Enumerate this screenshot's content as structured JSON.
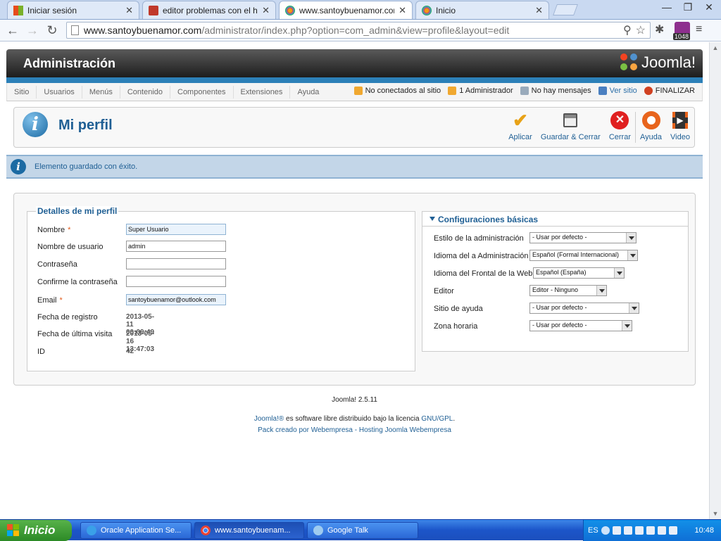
{
  "browser": {
    "tabs": [
      {
        "label": "Iniciar sesión",
        "active": false
      },
      {
        "label": "editor problemas con el html",
        "active": false
      },
      {
        "label": "www.santoybuenamor.com",
        "active": true
      },
      {
        "label": "Inicio",
        "active": false
      }
    ],
    "url_host": "www.santoybuenamor.com",
    "url_path": "/administrator/index.php?option=com_admin&view=profile&layout=edit",
    "badge_count": "1048"
  },
  "admin": {
    "header_title": "Administración",
    "logo_text": "Joomla!",
    "menu": [
      "Sitio",
      "Usuarios",
      "Menús",
      "Contenido",
      "Componentes",
      "Extensiones",
      "Ayuda"
    ],
    "status": {
      "not_connected": "No conectados al sitio",
      "admins": "1 Administrador",
      "messages": "No hay mensajes",
      "view_site": "Ver sitio",
      "logout": "FINALIZAR"
    }
  },
  "toolbar": {
    "page_title": "Mi perfil",
    "apply": "Aplicar",
    "save_close": "Guardar & Cerrar",
    "close": "Cerrar",
    "help": "Ayuda",
    "video": "Video"
  },
  "message": "Elemento guardado con éxito.",
  "profile": {
    "legend": "Detalles de mi perfil",
    "name_label": "Nombre",
    "name_value": "Super Usuario",
    "username_label": "Nombre de usuario",
    "username_value": "admin",
    "password_label": "Contraseña",
    "password_value": "",
    "confirm_label": "Confirme la contraseña",
    "confirm_value": "",
    "email_label": "Email",
    "email_value": "santoybuenamor@outlook.com",
    "register_label": "Fecha de registro",
    "register_value": "2013-05-11 00:09:49",
    "lastvisit_label": "Fecha de última visita",
    "lastvisit_value": "2013-05-16 13:47:03",
    "id_label": "ID",
    "id_value": "42",
    "required_mark": "*"
  },
  "settings": {
    "legend": "Configuraciones básicas",
    "admin_style_label": "Estilo de la administración",
    "admin_style_value": "- Usar por defecto -",
    "admin_lang_label": "Idioma del a Administración",
    "admin_lang_value": "Español (Formal Internacional)",
    "site_lang_label": "Idioma del Frontal de la Web",
    "site_lang_value": "Español (España)",
    "editor_label": "Editor",
    "editor_value": "Editor - Ninguno",
    "help_site_label": "Sitio de ayuda",
    "help_site_value": "- Usar por defecto -",
    "timezone_label": "Zona horaria",
    "timezone_value": "- Usar por defecto -"
  },
  "footer": {
    "version": "Joomla! 2.5.11",
    "license_link": "Joomla!®",
    "license_text": " es software libre distribuido bajo la licencia ",
    "license_gpl": "GNU/GPL",
    "license_end": ".",
    "pack_text": "Pack creado por ",
    "pack_link1": "Webempresa",
    "pack_sep": " - ",
    "pack_link2": "Hosting Joomla Webempresa"
  },
  "taskbar": {
    "start": "Inicio",
    "tasks": [
      "Oracle Application Se...",
      "www.santoybuenam...",
      "Google Talk"
    ],
    "lang": "ES",
    "clock": "10:48"
  }
}
